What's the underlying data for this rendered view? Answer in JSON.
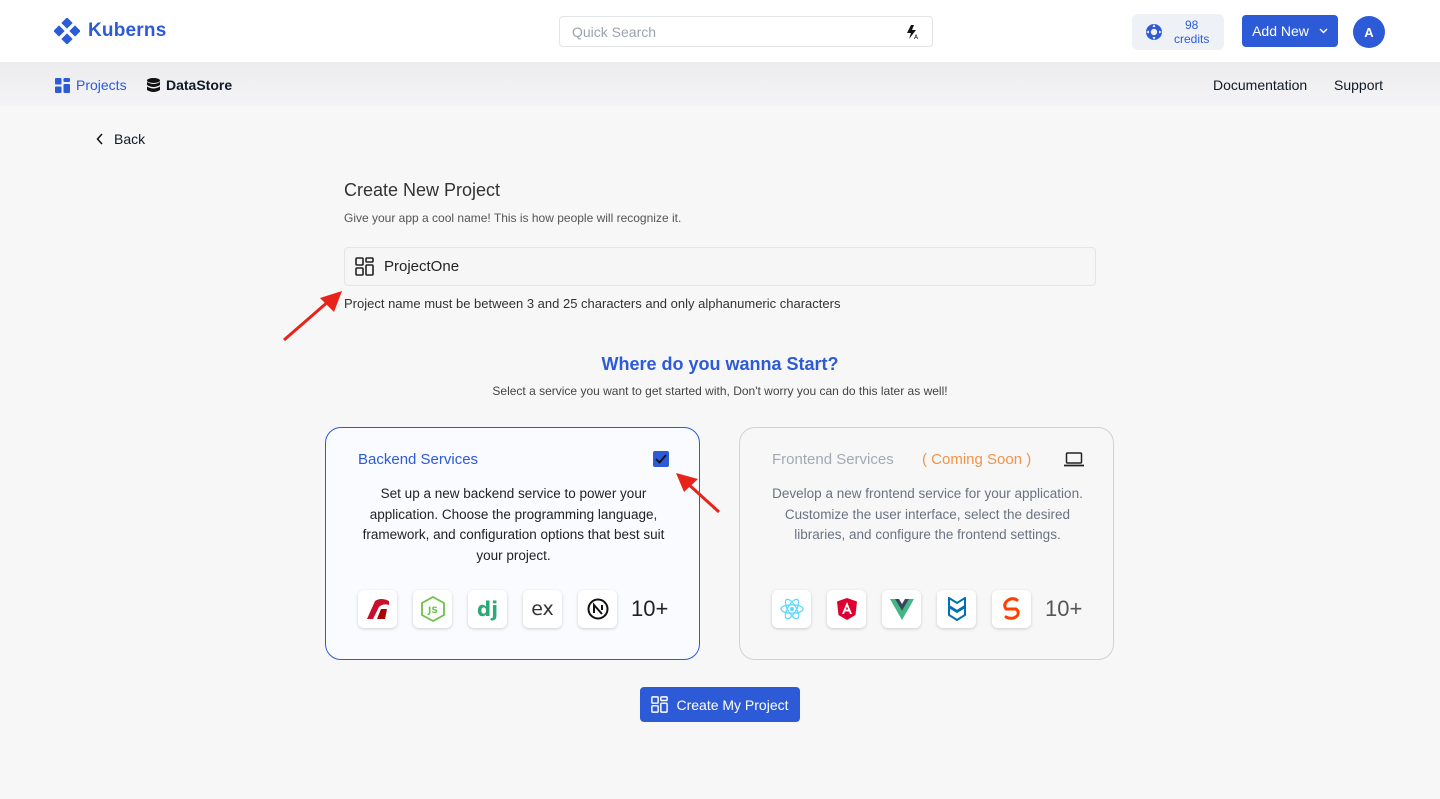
{
  "header": {
    "app_name": "Kuberns",
    "search_placeholder": "Quick Search",
    "credits_count": "98",
    "credits_label": "credits",
    "add_new_label": "Add New",
    "avatar_initial": "A"
  },
  "subnav": {
    "projects_label": "Projects",
    "datastore_label": "DataStore",
    "documentation_label": "Documentation",
    "support_label": "Support"
  },
  "back_label": "Back",
  "form": {
    "title": "Create New Project",
    "subtitle": "Give your app a cool name! This is how people will recognize it.",
    "project_name_value": "ProjectOne",
    "hint": "Project name must be between 3 and 25 characters and only alphanumeric characters"
  },
  "start": {
    "title": "Where do you wanna Start?",
    "subtitle": "Select a service you want to get started with, Don't worry you can do this later as well!"
  },
  "backend": {
    "title": "Backend Services",
    "checked": true,
    "description": "Set up a new backend service to power your application. Choose the programming language, framework, and configuration options that best suit your project.",
    "logos": [
      "rails-icon",
      "nodejs-icon",
      "django-icon",
      "express-icon",
      "nextjs-icon"
    ],
    "more": "10+"
  },
  "frontend": {
    "title": "Frontend Services",
    "coming_soon": "( Coming Soon )",
    "description": "Develop a new frontend service for your application. Customize the user interface, select the desired libraries, and configure the frontend settings.",
    "logos": [
      "react-icon",
      "angular-icon",
      "vue-icon",
      "backbone-icon",
      "svelte-icon"
    ],
    "more": "10+"
  },
  "create_button_label": "Create My Project",
  "colors": {
    "primary": "#2d5bd7",
    "coming_soon": "#f2934b",
    "annotation_arrow": "#e8231c"
  }
}
